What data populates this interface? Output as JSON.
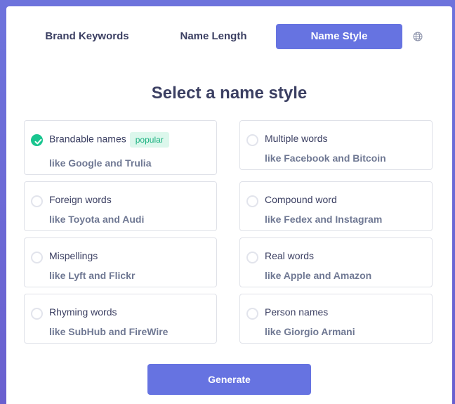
{
  "tabs": [
    {
      "label": "Brand Keywords",
      "active": false
    },
    {
      "label": "Name Length",
      "active": false
    },
    {
      "label": "Name Style",
      "active": true
    }
  ],
  "language_icon": "globe-icon",
  "title": "Select a name style",
  "options": [
    {
      "title": "Brandable names",
      "subtitle": "like Google and Trulia",
      "selected": true,
      "badge": "popular"
    },
    {
      "title": "Multiple words",
      "subtitle": "like Facebook and Bitcoin",
      "selected": false
    },
    {
      "title": "Foreign words",
      "subtitle": "like Toyota and Audi",
      "selected": false
    },
    {
      "title": "Compound word",
      "subtitle": "like Fedex and Instagram",
      "selected": false
    },
    {
      "title": "Mispellings",
      "subtitle": "like Lyft and Flickr",
      "selected": false
    },
    {
      "title": "Real words",
      "subtitle": "like Apple and Amazon",
      "selected": false
    },
    {
      "title": "Rhyming words",
      "subtitle": "like SubHub and FireWire",
      "selected": false
    },
    {
      "title": "Person names",
      "subtitle": "like Giorgio Armani",
      "selected": false
    }
  ],
  "generate_label": "Generate",
  "colors": {
    "accent": "#6673e1",
    "success": "#19c58f",
    "text": "#3b3f62",
    "muted": "#6f7893"
  }
}
